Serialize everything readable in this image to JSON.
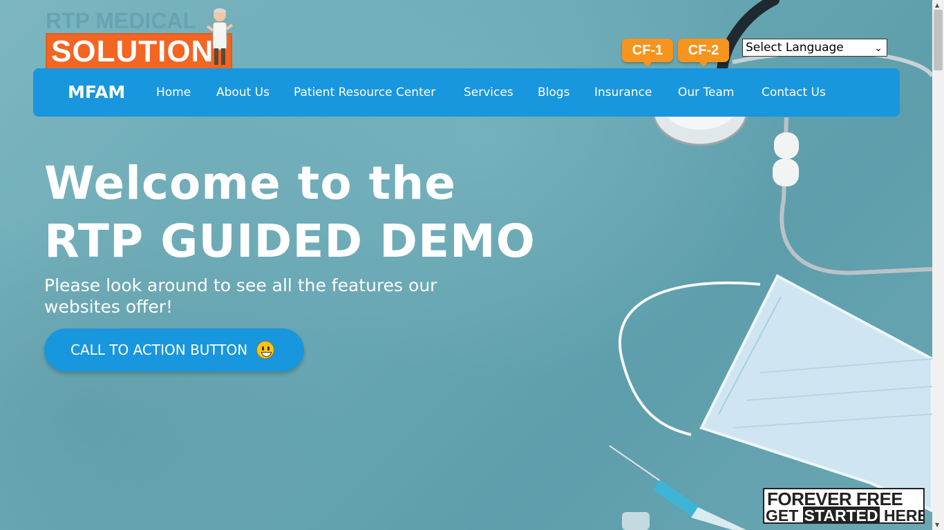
{
  "logo": {
    "top_text": "RTP MEDICAL",
    "main_text": "SOLUTION"
  },
  "badges": {
    "cf1": "CF-1",
    "cf2": "CF-2"
  },
  "language_select": {
    "selected": "Select Language"
  },
  "nav": {
    "brand": "MFAM",
    "items": [
      {
        "label": "Home"
      },
      {
        "label": "About Us"
      },
      {
        "label": "Patient Resource Center"
      },
      {
        "label": "Services"
      },
      {
        "label": "Blogs"
      },
      {
        "label": "Insurance"
      },
      {
        "label": "Our Team"
      },
      {
        "label": "Contact Us"
      }
    ]
  },
  "hero": {
    "title_line1": "Welcome to the",
    "title_line2": "RTP GUIDED DEMO",
    "subtitle": "Please look around to see all the features our websites offer!",
    "cta_label": "CALL TO ACTION BUTTON"
  },
  "promo": {
    "line1": "FOREVER FREE",
    "line2_a": "GET",
    "line2_b": "STARTED",
    "line2_c": "HERE"
  },
  "colors": {
    "nav_bg": "#1896de",
    "badge": "#f7941d",
    "logo_box": "#f26522",
    "background": "#6aa9b5"
  }
}
